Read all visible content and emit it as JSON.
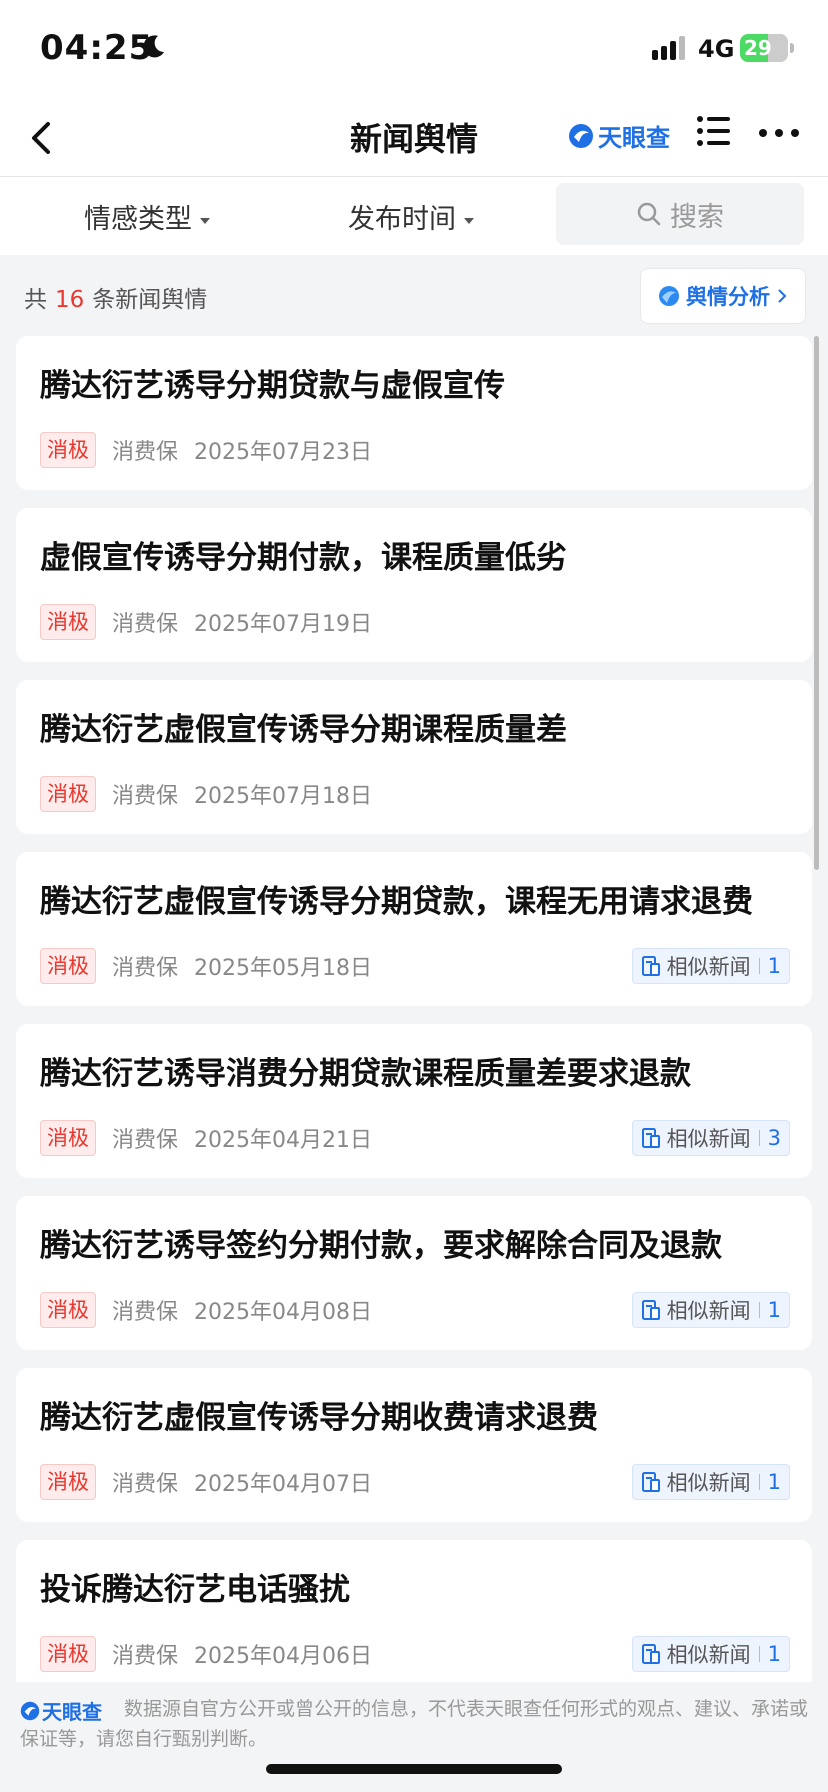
{
  "status_bar": {
    "time": "04:25",
    "network": "4G",
    "battery": "29"
  },
  "nav": {
    "title": "新闻舆情",
    "brand": "天眼查"
  },
  "filters": {
    "sentiment_label": "情感类型",
    "time_label": "发布时间",
    "search_placeholder": "搜索"
  },
  "summary": {
    "prefix": "共",
    "count": "16",
    "suffix": "条新闻舆情",
    "analysis_button": "舆情分析"
  },
  "colors": {
    "accent": "#1f6fe5",
    "negative": "#e8382f"
  },
  "news": [
    {
      "title": "腾达衍艺诱导分期贷款与虚假宣传",
      "tag": "消极",
      "source": "消费保",
      "date": "2025年07月23日",
      "similar_label": "",
      "similar_count": ""
    },
    {
      "title": "虚假宣传诱导分期付款，课程质量低劣",
      "tag": "消极",
      "source": "消费保",
      "date": "2025年07月19日",
      "similar_label": "",
      "similar_count": ""
    },
    {
      "title": "腾达衍艺虚假宣传诱导分期课程质量差",
      "tag": "消极",
      "source": "消费保",
      "date": "2025年07月18日",
      "similar_label": "",
      "similar_count": ""
    },
    {
      "title": "腾达衍艺虚假宣传诱导分期贷款，课程无用请求退费",
      "tag": "消极",
      "source": "消费保",
      "date": "2025年05月18日",
      "similar_label": "相似新闻",
      "similar_count": "1"
    },
    {
      "title": "腾达衍艺诱导消费分期贷款课程质量差要求退款",
      "tag": "消极",
      "source": "消费保",
      "date": "2025年04月21日",
      "similar_label": "相似新闻",
      "similar_count": "3"
    },
    {
      "title": "腾达衍艺诱导签约分期付款，要求解除合同及退款",
      "tag": "消极",
      "source": "消费保",
      "date": "2025年04月08日",
      "similar_label": "相似新闻",
      "similar_count": "1"
    },
    {
      "title": "腾达衍艺虚假宣传诱导分期收费请求退费",
      "tag": "消极",
      "source": "消费保",
      "date": "2025年04月07日",
      "similar_label": "相似新闻",
      "similar_count": "1"
    },
    {
      "title": "投诉腾达衍艺电话骚扰",
      "tag": "消极",
      "source": "消费保",
      "date": "2025年04月06日",
      "similar_label": "相似新闻",
      "similar_count": "1"
    }
  ],
  "footer": {
    "brand": "天眼查",
    "disclaimer": "数据源自官方公开或曾公开的信息，不代表天眼查任何形式的观点、建议、承诺或保证等，请您自行甄别判断。"
  }
}
